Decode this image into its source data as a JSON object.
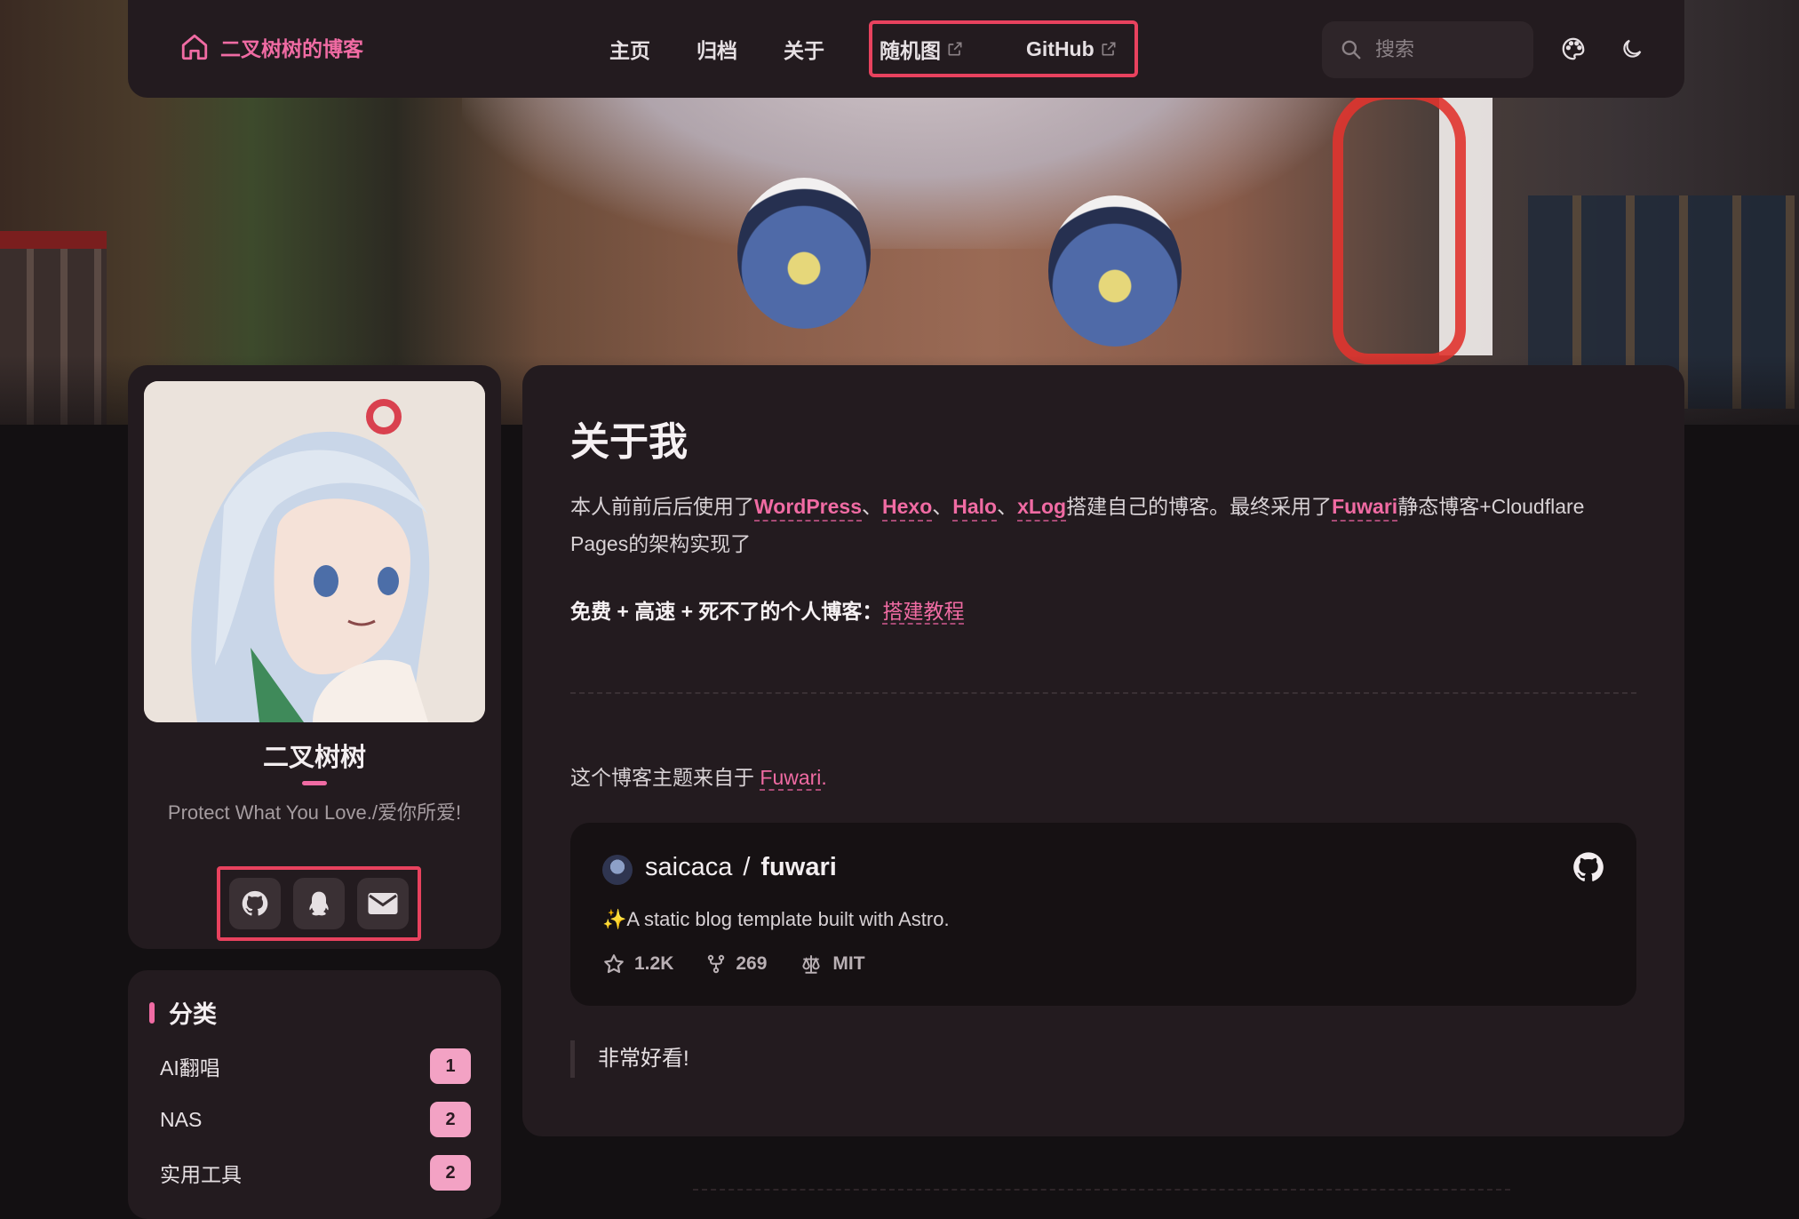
{
  "colors": {
    "accent": "#f06ba3",
    "highlight_box": "#e8425e",
    "card_bg": "#231b1f",
    "page_bg": "#131012"
  },
  "navbar": {
    "brand_icon": "home-icon",
    "brand_title": "二叉树树的博客",
    "links": [
      {
        "label": "主页"
      },
      {
        "label": "归档"
      },
      {
        "label": "关于"
      },
      {
        "label": "随机图",
        "external": true
      },
      {
        "label": "GitHub",
        "external": true
      }
    ],
    "search_placeholder": "搜索",
    "theme_icon": "palette-icon",
    "mode_icon": "moon-icon"
  },
  "profile": {
    "name": "二叉树树",
    "bio": "Protect What You Love./爱你所爱!",
    "social": [
      "github-icon",
      "qq-icon",
      "email-icon"
    ]
  },
  "categories": {
    "title": "分类",
    "items": [
      {
        "label": "AI翻唱",
        "count": "1"
      },
      {
        "label": "NAS",
        "count": "2"
      },
      {
        "label": "实用工具",
        "count": "2"
      }
    ]
  },
  "main": {
    "title": "关于我",
    "intro_prefix": "本人前前后后使用了",
    "intro_links": [
      "WordPress",
      "Hexo",
      "Halo",
      "xLog"
    ],
    "intro_sep": "、",
    "intro_mid": "搭建自己的博客。最终采用了",
    "intro_link_fuwari": "Fuwari",
    "intro_suffix": "静态博客+Cloudflare Pages的架构实现了",
    "tagline_bold": "免费 + 高速 + 死不了的个人博客：",
    "tagline_link": "搭建教程",
    "theme_prefix": "这个博客主题来自于 ",
    "theme_link": "Fuwari",
    "theme_suffix": ".",
    "repo": {
      "owner": "saicaca",
      "separator": "/",
      "name": "fuwari",
      "description": "✨A static blog template built with Astro.",
      "stars": "1.2K",
      "forks": "269",
      "license": "MIT"
    },
    "quote": "非常好看!"
  }
}
